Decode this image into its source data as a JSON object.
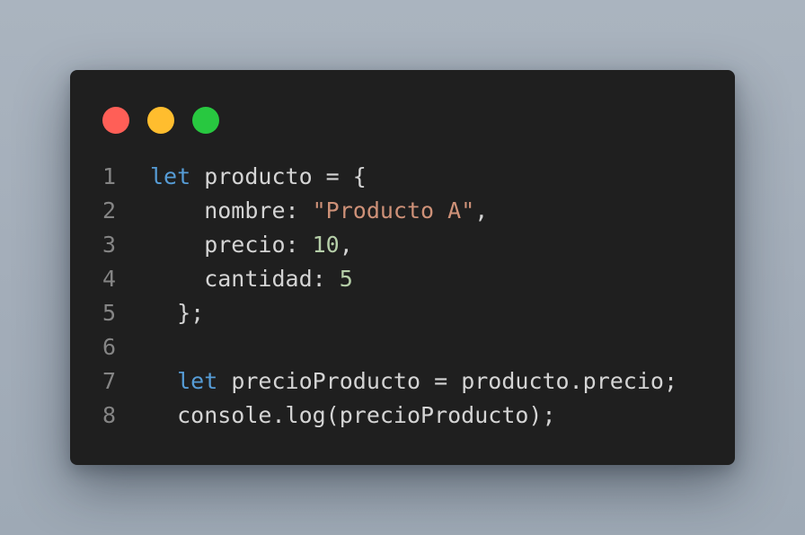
{
  "window_controls": {
    "close_color": "#ff5f57",
    "minimize_color": "#ffbd2e",
    "maximize_color": "#28c840"
  },
  "code_lines": [
    {
      "number": "1",
      "tokens": [
        {
          "text": "let",
          "type": "keyword"
        },
        {
          "text": " producto = {",
          "type": "text"
        }
      ]
    },
    {
      "number": "2",
      "tokens": [
        {
          "text": "    nombre: ",
          "type": "text"
        },
        {
          "text": "\"Producto A\"",
          "type": "string"
        },
        {
          "text": ",",
          "type": "text"
        }
      ]
    },
    {
      "number": "3",
      "tokens": [
        {
          "text": "    precio: ",
          "type": "text"
        },
        {
          "text": "10",
          "type": "number"
        },
        {
          "text": ",",
          "type": "text"
        }
      ]
    },
    {
      "number": "4",
      "tokens": [
        {
          "text": "    cantidad: ",
          "type": "text"
        },
        {
          "text": "5",
          "type": "number"
        }
      ]
    },
    {
      "number": "5",
      "tokens": [
        {
          "text": "  };",
          "type": "text"
        }
      ]
    },
    {
      "number": "6",
      "tokens": []
    },
    {
      "number": "7",
      "tokens": [
        {
          "text": "  ",
          "type": "text"
        },
        {
          "text": "let",
          "type": "keyword"
        },
        {
          "text": " precioProducto = producto.precio;",
          "type": "text"
        }
      ]
    },
    {
      "number": "8",
      "tokens": [
        {
          "text": "  console.log(precioProducto);",
          "type": "text"
        }
      ]
    }
  ]
}
